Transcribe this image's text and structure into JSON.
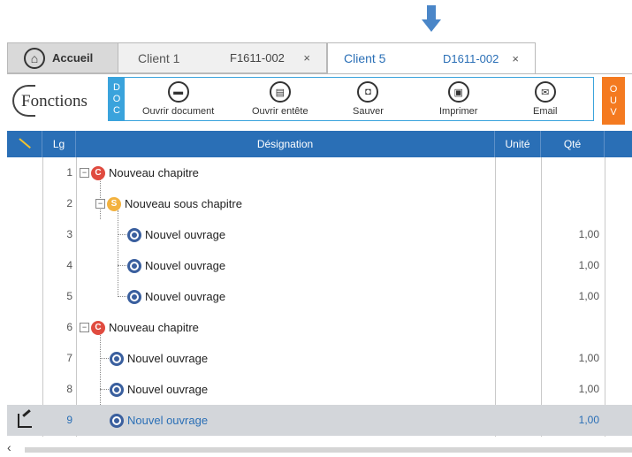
{
  "tabs": {
    "home": {
      "label": "Accueil"
    },
    "client1": {
      "client": "Client 1",
      "code": "F1611-002"
    },
    "client5": {
      "client": "Client 5",
      "code": "D1611-002"
    },
    "close_glyph": "×"
  },
  "toolbar": {
    "fonctions": "Fonctions",
    "doc_badge": [
      "D",
      "O",
      "C"
    ],
    "tools": [
      {
        "label": "Ouvrir document",
        "icon": "folder-icon"
      },
      {
        "label": "Ouvrir entête",
        "icon": "header-icon"
      },
      {
        "label": "Sauver",
        "icon": "save-icon"
      },
      {
        "label": "Imprimer",
        "icon": "printer-icon"
      },
      {
        "label": "Email",
        "icon": "email-icon"
      }
    ],
    "oux_badge": [
      "O",
      "U",
      "V"
    ]
  },
  "grid": {
    "headers": {
      "lg": "Lg",
      "designation": "Désignation",
      "unite": "Unité",
      "qte": "Qté"
    },
    "rows": [
      {
        "lg": "1",
        "type": "C",
        "label": "Nouveau chapitre",
        "qte": ""
      },
      {
        "lg": "2",
        "type": "S",
        "label": "Nouveau sous chapitre",
        "qte": ""
      },
      {
        "lg": "3",
        "type": "O",
        "label": "Nouvel ouvrage",
        "qte": "1,00"
      },
      {
        "lg": "4",
        "type": "O",
        "label": "Nouvel ouvrage",
        "qte": "1,00"
      },
      {
        "lg": "5",
        "type": "O",
        "label": "Nouvel ouvrage",
        "qte": "1,00"
      },
      {
        "lg": "6",
        "type": "C",
        "label": "Nouveau chapitre",
        "qte": ""
      },
      {
        "lg": "7",
        "type": "O",
        "label": "Nouvel ouvrage",
        "qte": "1,00"
      },
      {
        "lg": "8",
        "type": "O",
        "label": "Nouvel ouvrage",
        "qte": "1,00"
      },
      {
        "lg": "9",
        "type": "O",
        "label": "Nouvel ouvrage",
        "qte": "1,00",
        "selected": true
      }
    ]
  },
  "colors": {
    "accent": "#2a6fb6",
    "doc_badge": "#3aa3dc",
    "oux_badge": "#f47a20",
    "chapter": "#e04b3f",
    "subchapter": "#f3b23f",
    "ouvrage": "#3a5f9e"
  },
  "scroll": {
    "left_glyph": "‹"
  }
}
